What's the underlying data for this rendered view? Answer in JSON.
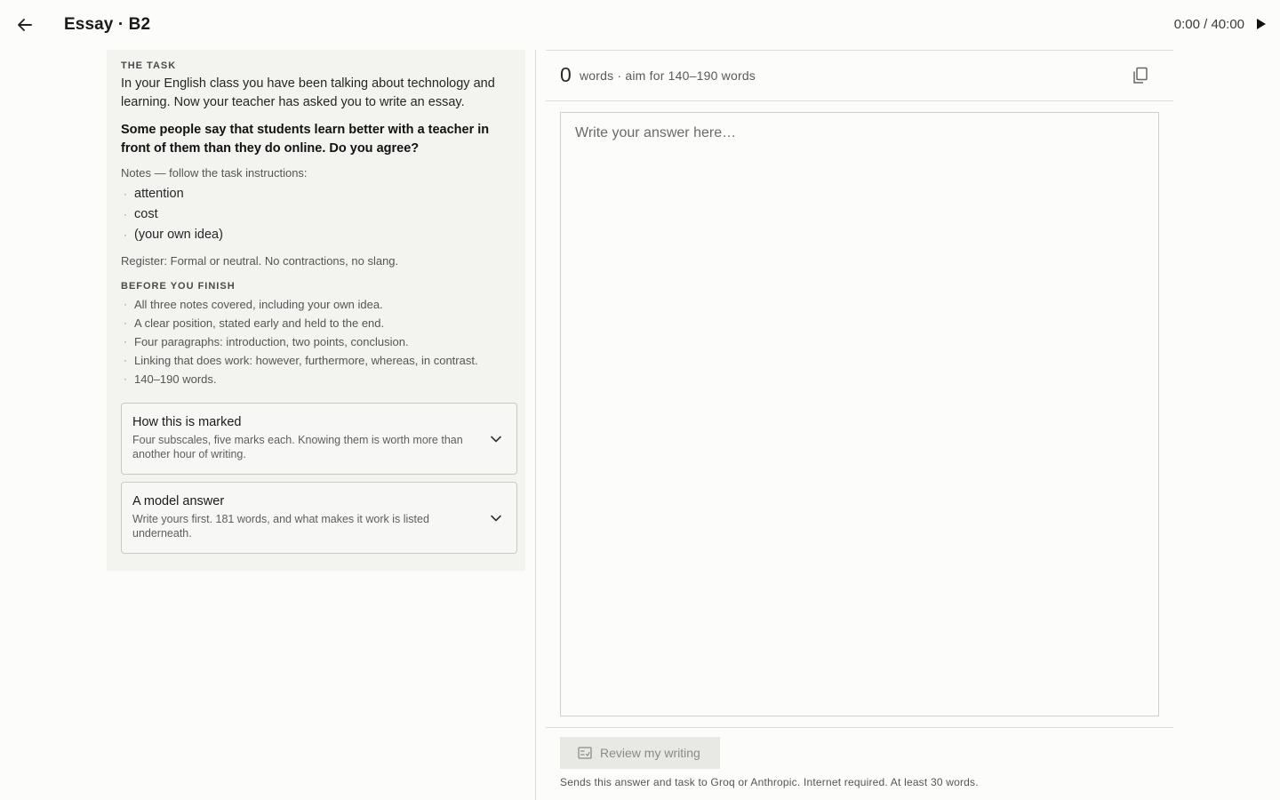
{
  "header": {
    "title": "Essay · B2",
    "timer": "0:00 / 40:00"
  },
  "task": {
    "section_label": "THE TASK",
    "intro": "In your English class you have been talking about technology and learning. Now your teacher has asked you to write an essay.",
    "question": "Some people say that students learn better with a teacher in front of them than they do online. Do you agree?",
    "notes_label": "Notes — follow the task instructions:",
    "notes": [
      "attention",
      "cost",
      "(your own idea)"
    ],
    "register": "Register: Formal or neutral. No contractions, no slang."
  },
  "checklist": {
    "label": "BEFORE YOU FINISH",
    "items": [
      "All three notes covered, including your own idea.",
      "A clear position, stated early and held to the end.",
      "Four paragraphs: introduction, two points, conclusion.",
      "Linking that does work: however, furthermore, whereas, in contrast.",
      "140–190 words."
    ]
  },
  "accordions": [
    {
      "title": "How this is marked",
      "subtitle": "Four subscales, five marks each. Knowing them is worth more than another hour of writing."
    },
    {
      "title": "A model answer",
      "subtitle": "Write yours first. 181 words, and what makes it work is listed underneath."
    }
  ],
  "editor": {
    "word_count": "0",
    "word_label": "words · aim for 140–190 words",
    "placeholder": "Write your answer here…",
    "review_label": "Review my writing",
    "review_note": "Sends this answer and task to Groq or Anthropic. Internet required. At least 30 words."
  }
}
